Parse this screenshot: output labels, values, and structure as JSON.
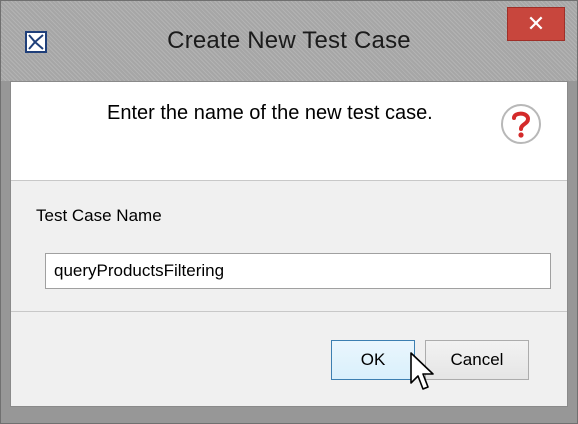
{
  "dialog": {
    "title": "Create New Test Case",
    "close_glyph": "✕",
    "message": "Enter the name of the new test case.",
    "icons": {
      "app": "test-case-icon",
      "question": "question-icon",
      "close": "close-icon"
    },
    "field": {
      "label": "Test Case Name",
      "value": "queryProductsFiltering"
    },
    "buttons": {
      "ok_label": "OK",
      "cancel_label": "Cancel"
    }
  },
  "colors": {
    "close_button": "#c8463d",
    "question_icon": "#d42a2a",
    "ok_button_border": "#3c7fb1"
  }
}
